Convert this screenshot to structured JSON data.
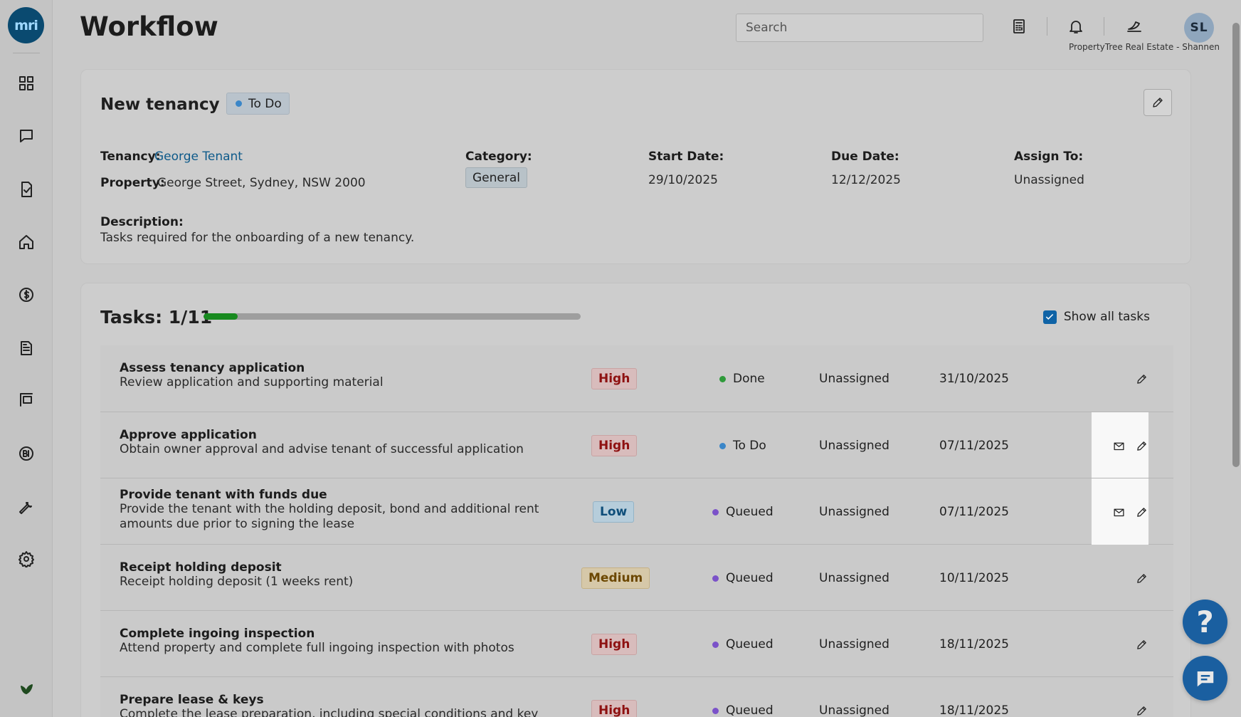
{
  "app": {
    "logo_text": "mri",
    "page_title": "Workflow",
    "search_placeholder": "Search",
    "user_initials": "SL",
    "org_label": "PropertyTree Real Estate - Shannen"
  },
  "sidebar": {
    "items": [
      {
        "name": "dashboard",
        "icon": "grid-icon"
      },
      {
        "name": "messages",
        "icon": "chat-icon"
      },
      {
        "name": "tasks",
        "icon": "checklist-icon"
      },
      {
        "name": "properties",
        "icon": "home-icon"
      },
      {
        "name": "finance",
        "icon": "dollar-icon"
      },
      {
        "name": "documents",
        "icon": "document-icon"
      },
      {
        "name": "listings",
        "icon": "sign-icon"
      },
      {
        "name": "bi",
        "icon": "bi-icon"
      },
      {
        "name": "maintenance",
        "icon": "wrench-icon"
      },
      {
        "name": "settings",
        "icon": "gear-icon"
      },
      {
        "name": "sustainability",
        "icon": "leaf-icon"
      }
    ]
  },
  "workflow": {
    "name": "New tenancy",
    "status": "To Do",
    "status_color": "#3a86c8",
    "tenancy_label": "Tenancy:",
    "tenancy_value": "George Tenant",
    "property_label": "Property:",
    "property_value": "George Street, Sydney, NSW 2000",
    "category_label": "Category:",
    "category_value": "General",
    "start_label": "Start Date:",
    "start_value": "29/10/2025",
    "due_label": "Due Date:",
    "due_value": "12/12/2025",
    "assign_label": "Assign To:",
    "assign_value": "Unassigned",
    "description_label": "Description:",
    "description_value": "Tasks required for the onboarding of a new tenancy."
  },
  "tasks_panel": {
    "title": "Tasks: 1/11",
    "progress": 0.091,
    "progress_color": "#188a1f",
    "show_all_label": "Show all tasks",
    "show_all_checked": true
  },
  "tasks": [
    {
      "title": "Assess tenancy application",
      "desc": "Review application and supporting material",
      "priority": "High",
      "status": "Done",
      "status_color": "#2e9a3a",
      "assignee": "Unassigned",
      "due": "31/10/2025",
      "email": false
    },
    {
      "title": "Approve application",
      "desc": "Obtain owner approval and advise tenant of successful application",
      "priority": "High",
      "status": "To Do",
      "status_color": "#3a86c8",
      "assignee": "Unassigned",
      "due": "07/11/2025",
      "email": true
    },
    {
      "title": "Provide tenant with funds due",
      "desc": "Provide the tenant with the holding deposit, bond and additional rent amounts due prior to signing the lease",
      "priority": "Low",
      "status": "Queued",
      "status_color": "#7b52c9",
      "assignee": "Unassigned",
      "due": "07/11/2025",
      "email": true
    },
    {
      "title": "Receipt holding deposit",
      "desc": "Receipt holding deposit (1 weeks rent)",
      "priority": "Medium",
      "status": "Queued",
      "status_color": "#7b52c9",
      "assignee": "Unassigned",
      "due": "10/11/2025",
      "email": false
    },
    {
      "title": "Complete ingoing inspection",
      "desc": "Attend property and complete full ingoing inspection with photos",
      "priority": "High",
      "status": "Queued",
      "status_color": "#7b52c9",
      "assignee": "Unassigned",
      "due": "18/11/2025",
      "email": false
    },
    {
      "title": "Prepare lease & keys",
      "desc": "Complete the lease preparation, including special conditions and key",
      "priority": "High",
      "status": "Queued",
      "status_color": "#7b52c9",
      "assignee": "Unassigned",
      "due": "18/11/2025",
      "email": false
    }
  ],
  "help": {
    "label": "?"
  }
}
